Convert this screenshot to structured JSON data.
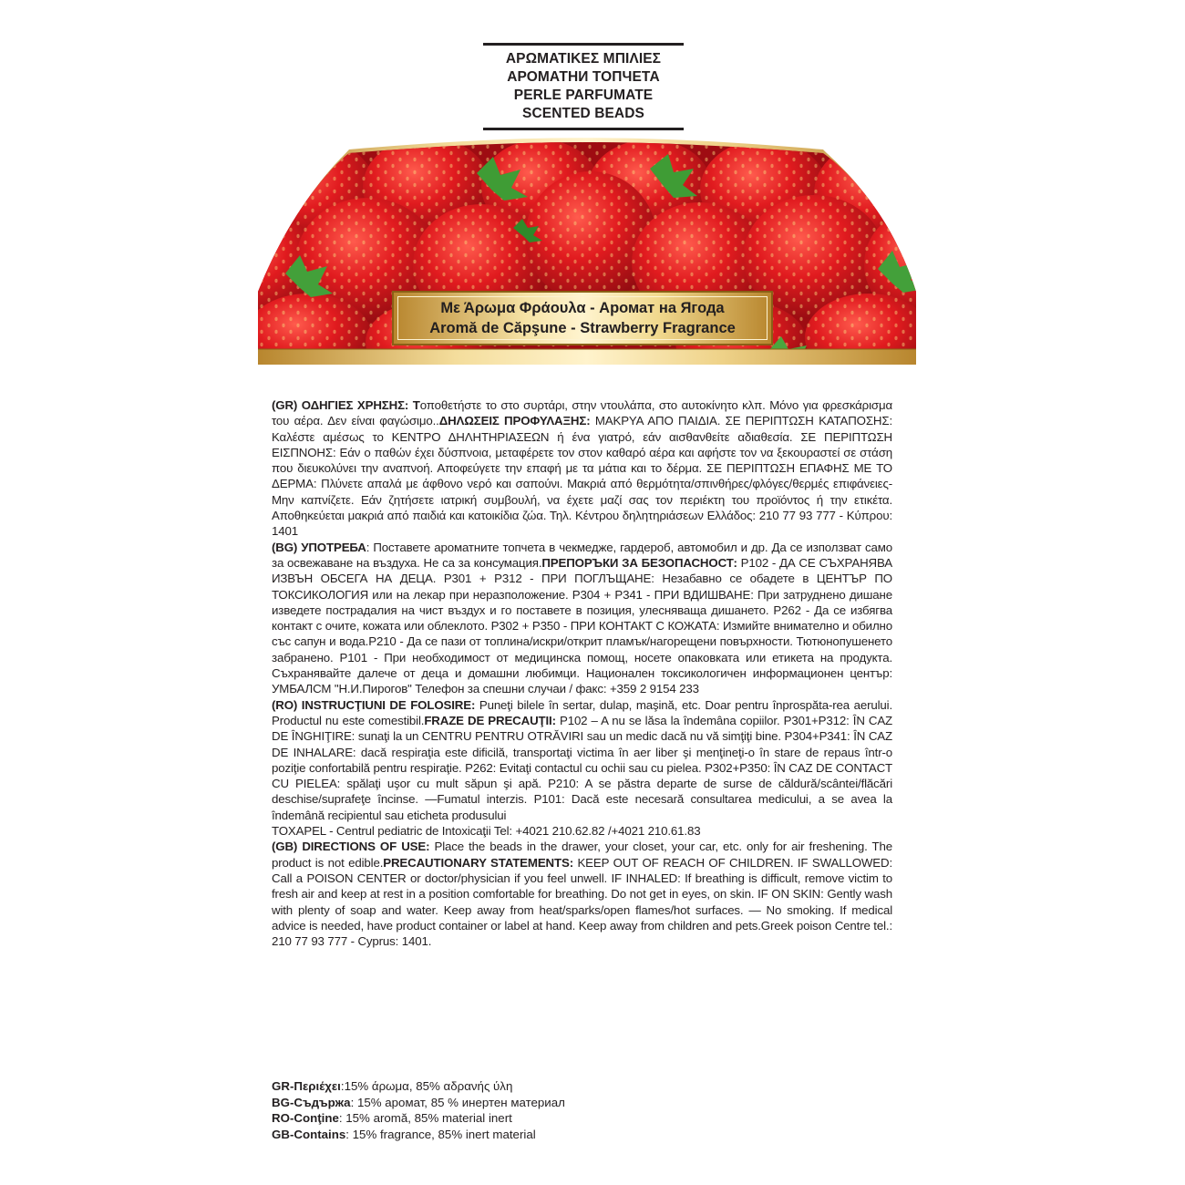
{
  "header": {
    "lines": [
      "ΑΡΩΜΑΤΙΚΕΣ ΜΠΙΛΙΕΣ",
      "АРОМАТНИ ТОПЧЕТА",
      "PERLE PARFUMATE",
      "SCENTED BEADS"
    ]
  },
  "banner": {
    "line1": "Με Άρωμα Φράουλα - Аромат на Ягода",
    "line2": "Aromă de Căpşune  - Strawberry Fragrance",
    "colors": {
      "strawberry": "#d6141c",
      "gold": "#c9a04a",
      "leaf": "#3f9c35"
    }
  },
  "sections": {
    "gr": {
      "label": "(GR) ΟΔΗΓΙΕΣ ΧΡΗΣΗΣ:",
      "lead": "T",
      "text1": "οποθετήστε το στο συρτάρι, στην ντουλάπα, στο αυτοκίνητο κλπ. Μόνο για φρεσκάρισμα του αέρα. Δεν είναι φαγώσιμο..",
      "label2": "ΔΗΛΩΣΕΙΣ ΠΡΟΦΥΛΑΞΗΣ:",
      "text2": " ΜΑΚΡΥΑ ΑΠΟ ΠΑΙΔΙΑ. ΣΕ ΠΕΡΙΠΤΩΣΗ ΚΑΤΑΠΟΣΗΣ: Καλέστε αμέσως το ΚΕΝΤΡΟ ΔΗΛΗΤΗΡΙΑΣΕΩΝ ή ένα γιατρό, εάν αισθανθείτε αδιαθεσία. ΣΕ ΠΕΡΙΠΤΩΣΗ ΕΙΣΠΝΟΗΣ: Εάν ο παθών έχει δύσπνοια, μεταφέρετε τον στον καθαρό αέρα και αφήστε τον να ξεκουραστεί σε στάση που διευκολύνει την αναπνοή. Αποφεύγετε την επαφή με τα μάτια και το δέρμα. ΣΕ ΠΕΡΙΠΤΩΣΗ ΕΠΑΦΗΣ ΜΕ ΤΟ ΔΕΡΜΑ: Πλύνετε απαλά με άφθονο νερό και σαπούνι. Μακριά από θερμότητα/σπινθήρες/φλόγες/θερμές επιφάνειες-Μην καπνίζετε. Εάν ζητήσετε ιατρική συμβουλή, να έχετε μαζί σας τον περιέκτη του προϊόντος ή την ετικέτα. Αποθηκεύεται μακριά από παιδιά και κατοικίδια ζώα. Τηλ. Κέντρου δηλητηριάσεων Ελλάδος: 210 77 93 777  - Κύπρου: 1401"
    },
    "bg": {
      "label": "(BG) УПОТРЕБА",
      "text1": ": Поставете ароматните топчета в чекмедже, гардероб, автомобил и др. Да се използват само за освежаване на въздуха. Не са за консумация.",
      "label2": "ПРЕПОРЪКИ ЗА БЕЗОПАСНОСТ:",
      "text2": " P102 - ДА СЕ СЪХРАНЯВА ИЗВЪН ОБСЕГА НА ДЕЦА. P301 + P312 - ПРИ ПОГЛЪЩАНЕ: Незабавно се обадете в ЦЕНТЪР ПО ТОКСИКОЛОГИЯ или на лекар при неразположение. P304 + P341 - ПРИ ВДИШВАНЕ: При затруднено дишане изведете пострадалия на чист въздух и го поставете в позиция, улесняваща дишането. P262 - Да се избягва контакт с очите, кожата или облеклото. P302 + P350 - ПРИ КОНТАКТ С КОЖАТА: Измийте внимателно и обилно със сапун и вода.P210 - Да се пази от топлина/искри/открит пламък/нагорещени повърхности. Тютюнопушенето забранено. P101 - При необходимост от медицинска помощ, носете опаковката или етикета на продукта. Съхранявайте далече от деца и домашни любимци.  Национален токсикологичен информационен център: УМБАЛСМ \"Н.И.Пирогов\" Телефон за спешни случаи / факс: +359 2 9154 233"
    },
    "ro": {
      "label": "(RO) INSTRUCŢIUNI DE FOLOSIRE:",
      "text1": " Puneţi bilele în sertar, dulap, maşină, etc. Doar pentru înprospăta-rea aerului. Produсtul nu este comestibil.",
      "label2": "FRAZE DE  PRECAUŢII:",
      "text2": " P102 –  A nu se lăsa la îndemâna copiilor. P301+P312: ÎN CAZ DE ÎNGHIŢIRE: sunaţi la un CENTRU PENTRU OTRĂVIRI sau un medic dacă nu vă simţiţi bine. P304+P341: ÎN CAZ DE INHALARE: dacă respiraţia este dificilă, transportaţi victima în aer liber şi menţineţi-o în stare de repaus într-o poziţie confortabilă pentru respiraţie. P262: Evitaţi contactul cu ochii sau cu pielea. P302+P350: ÎN CAZ DE CONTACT CU PIELEA: spălaţi uşor cu mult săpun şi apă. P210: A se păstra departe de surse de căldură/scântei/flăcări deschise/suprafeţe încinse. —Fumatul interzis. P101: Dacă este necesară consultarea medicului, a se avea la îndemână recipientul sau eticheta produsului",
      "toxapel": "TOXAPEL - Centrul pediatric de Intoxicaţii Tel: +4021 210.62.82  /+4021 210.61.83"
    },
    "gb": {
      "label": "(GB) DIRECTIONS OF USE:",
      "text1": " Place the beads in the drawer, your closet, your car, etc. only for air freshening. The product is not edible.",
      "label2": "PRECAUTIONARY STATEMENTS:",
      "text2": " KEEP OUT OF REACH OF CHILDREN. IF SWALLOWED: Call a POISON CENTER or doctor/physician if you feel unwell. IF INHALED: If breathing is difficult, remove victim to fresh air and keep at rest in a position comfortable for breathing. Do not get in eyes, on skin. IF ON SKIN: Gently wash with plenty of soap and water. Keep away from heat/sparks/open flames/hot surfaces. — No smoking. If medical advice is needed, have product container or label at hand. Keep away from children and pets.Greek poison Centre tel.: 210 77 93 777 - Cyprus: 1401."
    }
  },
  "contents": [
    {
      "label": "GR-Περιέχει",
      "text": ":15% άρωμα, 85% αδρανής ύλη"
    },
    {
      "label": "BG-Съдържа",
      "text": ": 15% аромат, 85 % инертен материал"
    },
    {
      "label": "RO-Conţine",
      "text": ": 15% aromă, 85% material inert"
    },
    {
      "label": "GB-Contains",
      "text": ": 15% fragrance, 85% inert material"
    }
  ]
}
